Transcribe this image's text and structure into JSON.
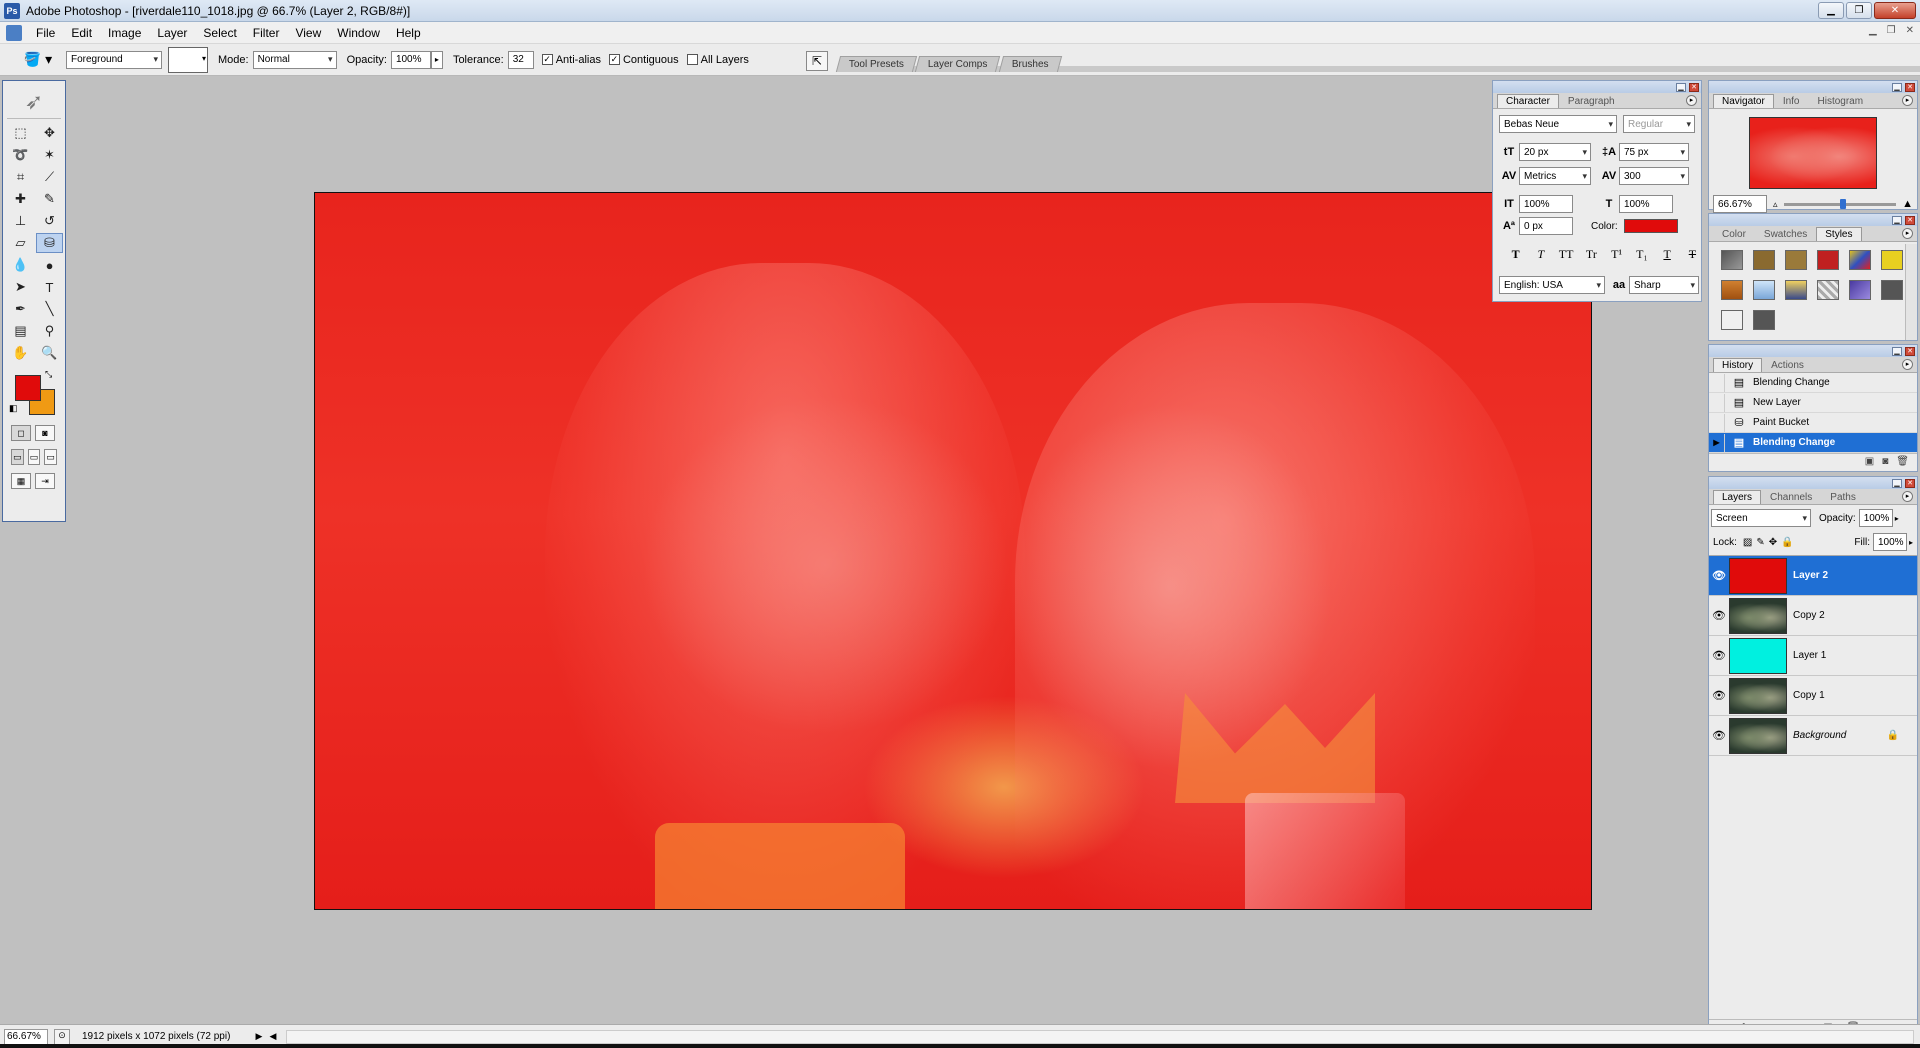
{
  "window": {
    "title": "Adobe Photoshop - [riverdale110_1018.jpg @ 66.7% (Layer 2, RGB/8#)]"
  },
  "menu": [
    "File",
    "Edit",
    "Image",
    "Layer",
    "Select",
    "Filter",
    "View",
    "Window",
    "Help"
  ],
  "options": {
    "fill_source": "Foreground",
    "mode_label": "Mode:",
    "mode": "Normal",
    "opacity_label": "Opacity:",
    "opacity": "100%",
    "tolerance_label": "Tolerance:",
    "tolerance": "32",
    "anti_alias": "Anti-alias",
    "contiguous": "Contiguous",
    "all_layers": "All Layers"
  },
  "well_tabs": [
    "Tool Presets",
    "Layer Comps",
    "Brushes"
  ],
  "colors": {
    "foreground": "#e00b0b",
    "background": "#f09a14",
    "selection": "#1f6fd4"
  },
  "character": {
    "tabs": [
      "Character",
      "Paragraph"
    ],
    "font_family": "Bebas Neue",
    "font_style": "Regular",
    "size": "20 px",
    "leading": "75 px",
    "kerning": "Metrics",
    "tracking": "300",
    "vscale": "100%",
    "hscale": "100%",
    "baseline": "0 px",
    "color_label": "Color:",
    "language": "English: USA",
    "aa_icon": "aa",
    "antialias": "Sharp"
  },
  "navigator": {
    "tabs": [
      "Navigator",
      "Info",
      "Histogram"
    ],
    "zoom": "66.67%"
  },
  "swatch_panel": {
    "tabs": [
      "Color",
      "Swatches",
      "Styles"
    ]
  },
  "history": {
    "tabs": [
      "History",
      "Actions"
    ],
    "items": [
      "Blending Change",
      "New Layer",
      "Paint Bucket",
      "Blending Change"
    ]
  },
  "layers": {
    "tabs": [
      "Layers",
      "Channels",
      "Paths"
    ],
    "blend_mode": "Screen",
    "opacity_label": "Opacity:",
    "opacity": "100%",
    "lock_label": "Lock:",
    "fill_label": "Fill:",
    "fill": "100%",
    "items": [
      "Layer 2",
      "Copy 2",
      "Layer 1",
      "Copy 1",
      "Background"
    ]
  },
  "status": {
    "zoom": "66.67%",
    "doc_info": "1912 pixels x 1072 pixels (72 ppi)"
  }
}
